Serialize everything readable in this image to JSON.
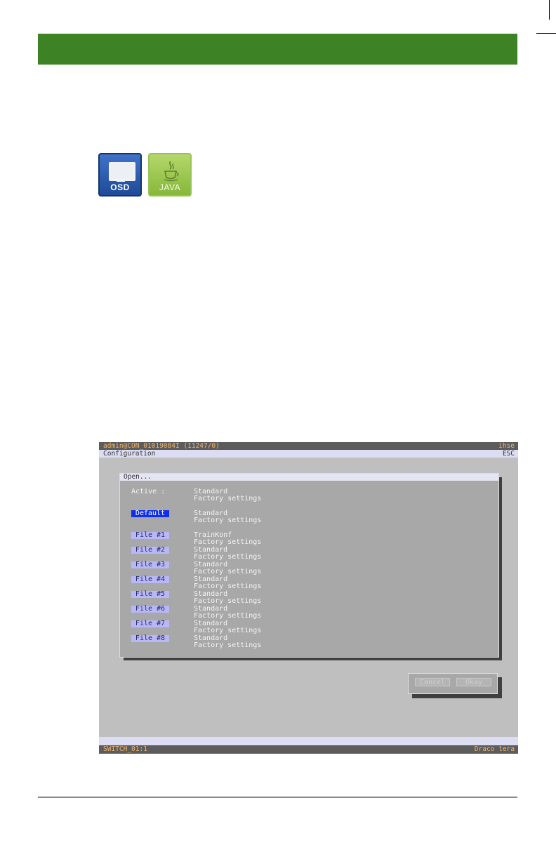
{
  "icons": {
    "osd": {
      "label": "OSD",
      "icon": "monitor-icon",
      "color": "#2756a8"
    },
    "java": {
      "label": "JAVA",
      "icon": "java-cup-icon",
      "color": "#9fca55"
    }
  },
  "header": {
    "color": "#3d8224"
  },
  "osd": {
    "title_left": "admin@CON_01019084I (11247/0)",
    "title_right": "ihse",
    "menu_left": "Configuration",
    "menu_right": "ESC",
    "dialog_title": "Open...",
    "active_label": "Active  :",
    "active": {
      "name": "Standard",
      "desc": "Factory settings"
    },
    "default_button": "Default",
    "default": {
      "name": "Standard",
      "desc": "Factory settings"
    },
    "files": [
      {
        "button": "File #1",
        "name": "TrainKonf",
        "desc": "Factory settings"
      },
      {
        "button": "File #2",
        "name": "Standard",
        "desc": "Factory settings"
      },
      {
        "button": "File #3",
        "name": "Standard",
        "desc": "Factory settings"
      },
      {
        "button": "File #4",
        "name": "Standard",
        "desc": "Factory settings"
      },
      {
        "button": "File #5",
        "name": "Standard",
        "desc": "Factory settings"
      },
      {
        "button": "File #6",
        "name": "Standard",
        "desc": "Factory settings"
      },
      {
        "button": "File #7",
        "name": "Standard",
        "desc": "Factory settings"
      },
      {
        "button": "File #8",
        "name": "Standard",
        "desc": "Factory settings"
      }
    ],
    "cancel_label": "Cancel",
    "okay_label": "Okay",
    "status_left": "SWITCH_01:1",
    "status_right": "Draco tera"
  }
}
